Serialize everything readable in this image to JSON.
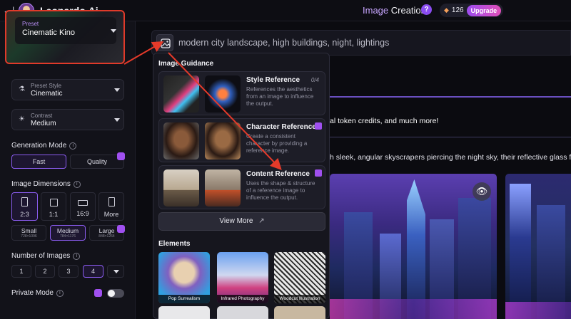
{
  "topbar": {
    "back_icon": "←|",
    "brand": "Leonardo.Ai",
    "mode_part1": "Image",
    "mode_part2": " Creation",
    "help": "?",
    "credits": "126",
    "upgrade": "Upgrade"
  },
  "sidebar": {
    "preset": {
      "label": "Preset",
      "value": "Cinematic Kino"
    },
    "preset_style": {
      "label": "Preset Style",
      "value": "Cinematic"
    },
    "contrast": {
      "label": "Contrast",
      "value": "Medium"
    },
    "generation_mode": {
      "title": "Generation Mode",
      "options": [
        "Fast",
        "Quality"
      ],
      "selected": "Fast"
    },
    "image_dimensions": {
      "title": "Image Dimensions",
      "ratios": [
        "2:3",
        "1:1",
        "16:9",
        "More"
      ],
      "sizes": [
        {
          "label": "Small",
          "sub": "728×1096"
        },
        {
          "label": "Medium",
          "sub": "784×1176"
        },
        {
          "label": "Large",
          "sub": "848×1264"
        }
      ]
    },
    "number_of_images": {
      "title": "Number of Images",
      "options": [
        "1",
        "2",
        "3",
        "4"
      ],
      "selected": "4"
    },
    "private_mode": {
      "title": "Private Mode"
    }
  },
  "prompt": {
    "text": "modern city landscape, high buildings, night, lightings"
  },
  "background": {
    "text1": "al token credits, and much more!",
    "text2": "h sleek, angular skyscrapers piercing the night sky, their reflective glass fac"
  },
  "guidance": {
    "title": "Image Guidance",
    "cards": [
      {
        "name": "Style Reference",
        "desc": "References the aesthetics from an image to influence the output.",
        "count": "0/4"
      },
      {
        "name": "Character Reference",
        "desc": "Create a consistent character by providing a reference image."
      },
      {
        "name": "Content Reference",
        "desc": "Uses the shape & structure of a reference image to influence the output."
      }
    ],
    "view_more": "View More"
  },
  "elements": {
    "title": "Elements",
    "items": [
      "Pop Surrealism",
      "Infrared Photography",
      "Woodcut Illustration"
    ]
  },
  "colors": {
    "accent": "#8b5cf0",
    "arrow": "#e53a2a"
  }
}
